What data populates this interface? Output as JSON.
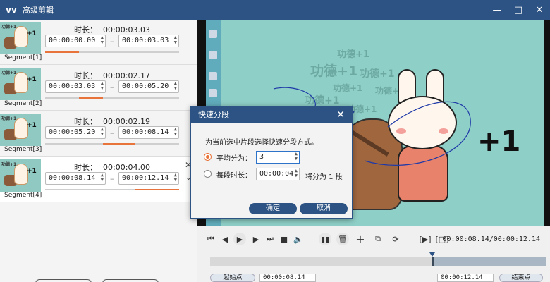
{
  "window": {
    "title": "高级剪辑",
    "logo": "vv-logo",
    "minimize_icon": "minimize-icon",
    "maximize_icon": "maximize-icon",
    "close_icon": "close-icon"
  },
  "segments": [
    {
      "name": "Segment[1]",
      "duration_label": "时长：",
      "duration": "00:00:03.03",
      "start": "00:00:00.00",
      "end": "00:00:03.03",
      "progress_start": 0.0,
      "progress_end": 0.25,
      "thumb_text": "功德+1"
    },
    {
      "name": "Segment[2]",
      "duration_label": "时长：",
      "duration": "00:00:02.17",
      "start": "00:00:03.03",
      "end": "00:00:05.20",
      "progress_start": 0.25,
      "progress_end": 0.43,
      "thumb_text": "功德+1"
    },
    {
      "name": "Segment[3]",
      "duration_label": "时长：",
      "duration": "00:00:02.19",
      "start": "00:00:05.20",
      "end": "00:00:08.14",
      "progress_start": 0.43,
      "progress_end": 0.67,
      "thumb_text": "功德+1"
    },
    {
      "name": "Segment[4]",
      "duration_label": "时长：",
      "duration": "00:00:04.00",
      "start": "00:00:08.14",
      "end": "00:00:12.14",
      "progress_start": 0.67,
      "progress_end": 1.0,
      "thumb_text": "功德+1"
    }
  ],
  "video": {
    "overlay_texts": [
      "功德+1",
      "功德+1",
      "功德+1",
      "功德+1",
      "功德+1",
      "功德+1",
      "功德+1"
    ],
    "big_text": "+1"
  },
  "dialog": {
    "title": "快速分段",
    "prompt": "为当前选中片段选择快速分段方式。",
    "option_avg_label": "平均分为：",
    "option_avg_value": "3",
    "option_time_label": "每段时长：",
    "option_time_value": "00:00:04",
    "split_note": "将分为 1 段",
    "ok": "确定",
    "cancel": "取消",
    "selected_option": "average"
  },
  "player": {
    "timecode": "00:00:08.14/00:00:12.14",
    "start_label": "起始点",
    "start_value": "00:00:08.14",
    "end_value": "00:00:12.14",
    "end_label": "结束点",
    "selection_start": 0.67,
    "selection_end": 1.0
  },
  "colors": {
    "accent": "#e8743b",
    "brand": "#2c5383"
  }
}
